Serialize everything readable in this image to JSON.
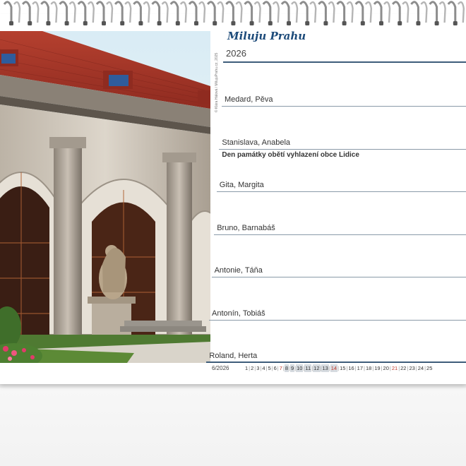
{
  "calendar": {
    "title": "Miluju Prahu",
    "year": "2026",
    "photo_credit": "© Klára Hálová / MilujuPrahu.cz, 2025",
    "days": [
      {
        "names": "Medard, Pěva",
        "note": ""
      },
      {
        "names": "Stanislava, Anabela",
        "note": "Den památky obětí vyhlazení obce Lidice"
      },
      {
        "names": "Gita, Margita",
        "note": ""
      },
      {
        "names": "Bruno, Barnabáš",
        "note": ""
      },
      {
        "names": "Antonie, Táňa",
        "note": ""
      },
      {
        "names": "Antonín, Tobiáš",
        "note": ""
      },
      {
        "names": "Roland, Herta",
        "note": ""
      }
    ],
    "month_label": "6/2026",
    "month_days": [
      "1",
      "2",
      "3",
      "4",
      "5",
      "6",
      "7",
      "8",
      "9",
      "10",
      "11",
      "12",
      "13",
      "14",
      "15",
      "16",
      "17",
      "18",
      "19",
      "20",
      "21",
      "22",
      "23",
      "24",
      "25"
    ],
    "weekend_days": [
      "6",
      "7",
      "13",
      "14",
      "20",
      "21"
    ],
    "highlight_week": [
      "8",
      "9",
      "10",
      "11",
      "12",
      "13",
      "14"
    ],
    "red_days": [
      "7",
      "14",
      "21"
    ]
  },
  "colors": {
    "title": "#1d4b7a",
    "rule": "#3e5d7a",
    "sunday": "#c0392b"
  }
}
